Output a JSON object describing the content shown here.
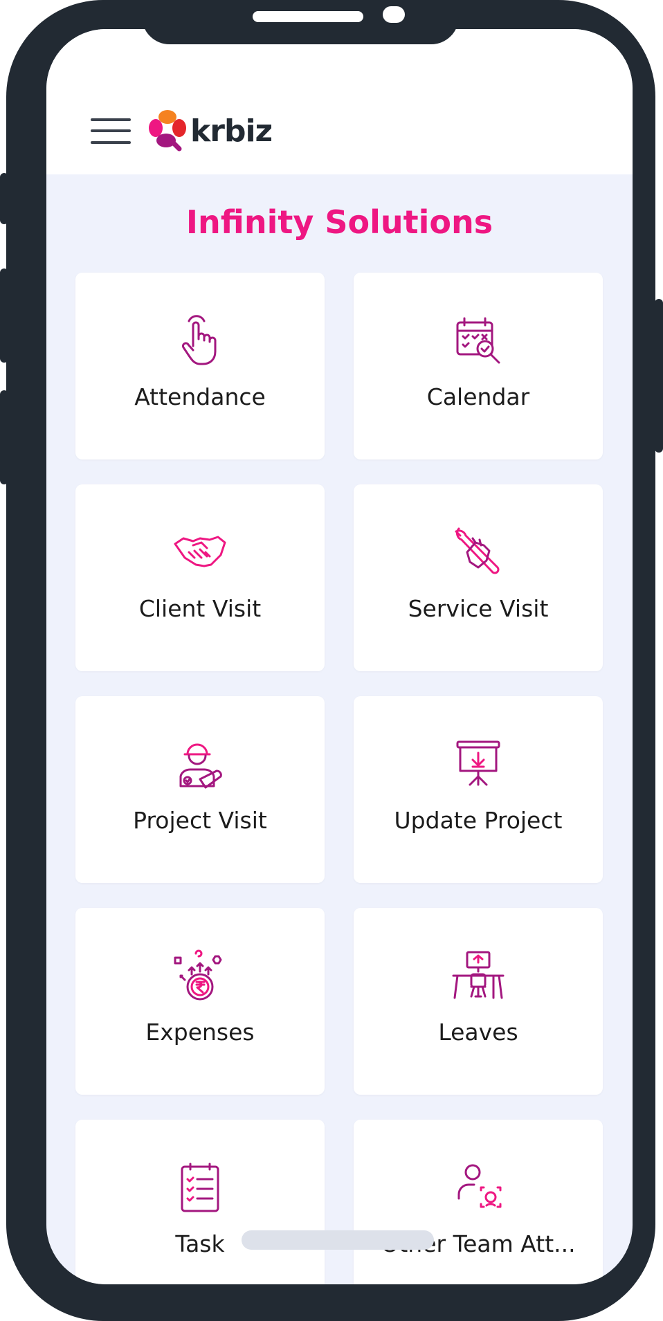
{
  "app": {
    "logo_text": "krbiz",
    "organization": "Infinity Solutions"
  },
  "colors": {
    "accent": "#ee1782",
    "icon": "#a3177f",
    "frame": "#222a33",
    "background": "#eff2fc"
  },
  "header": {
    "menu_icon": "hamburger-icon"
  },
  "tiles": [
    {
      "label": "Attendance",
      "icon": "tap-finger-icon"
    },
    {
      "label": "Calendar",
      "icon": "calendar-search-icon"
    },
    {
      "label": "Client Visit",
      "icon": "handshake-icon"
    },
    {
      "label": "Service Visit",
      "icon": "wrench-hand-icon"
    },
    {
      "label": "Project Visit",
      "icon": "engineer-blueprint-icon"
    },
    {
      "label": "Update Project",
      "icon": "presentation-board-icon"
    },
    {
      "label": "Expenses",
      "icon": "rupee-coin-icon"
    },
    {
      "label": "Leaves",
      "icon": "empty-desk-icon"
    },
    {
      "label": "Task",
      "icon": "checklist-icon"
    },
    {
      "label": "Other Team Att...",
      "icon": "face-scan-person-icon"
    }
  ]
}
